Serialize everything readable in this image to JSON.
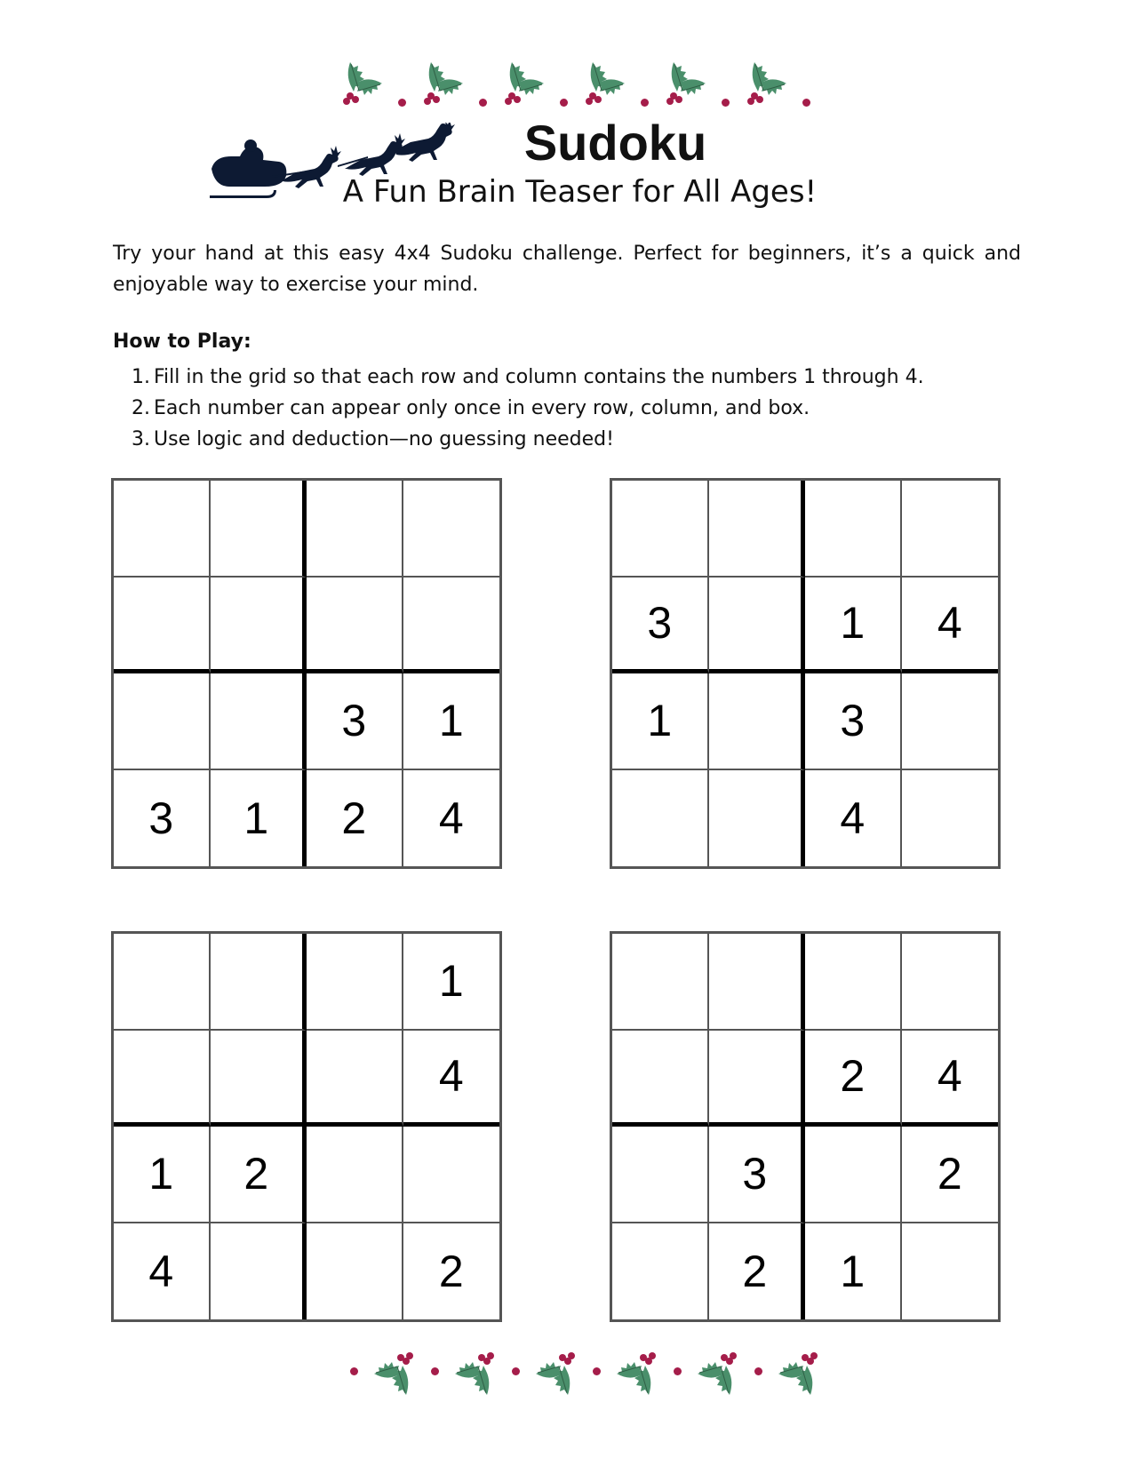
{
  "decoration": {
    "top_icons": [
      "holly-icon",
      "holly-icon",
      "holly-icon",
      "holly-icon",
      "holly-icon",
      "holly-icon"
    ],
    "bottom_icons": [
      "holly-icon",
      "holly-icon",
      "holly-icon",
      "holly-icon",
      "holly-icon",
      "holly-icon"
    ],
    "sleigh_icon": "santa-sleigh-reindeer-icon",
    "colors": {
      "leaf": "#4a8f6b",
      "berry": "#a51d4a",
      "sleigh": "#0d1a33"
    }
  },
  "header": {
    "title": "Sudoku",
    "subtitle": "A Fun Brain Teaser for All Ages!"
  },
  "intro": "Try your hand at this easy 4x4 Sudoku challenge. Perfect for beginners, it’s a quick and enjoyable way to exercise your mind.",
  "how_to_play": {
    "heading": "How to Play:",
    "rules": [
      {
        "num": "1.",
        "text": "Fill in the grid so that each row and column contains the numbers 1 through 4."
      },
      {
        "num": "2.",
        "text": "Each number can appear only once in every row, column, and box."
      },
      {
        "num": "3.",
        "text": "Use logic and deduction—no guessing needed!"
      }
    ]
  },
  "puzzles": [
    {
      "cells": [
        [
          "",
          "",
          "",
          ""
        ],
        [
          "",
          "",
          "",
          ""
        ],
        [
          "",
          "",
          "3",
          "1"
        ],
        [
          "3",
          "1",
          "2",
          "4"
        ]
      ]
    },
    {
      "cells": [
        [
          "",
          "",
          "",
          ""
        ],
        [
          "3",
          "",
          "1",
          "4"
        ],
        [
          "1",
          "",
          "3",
          ""
        ],
        [
          "",
          "",
          "4",
          ""
        ]
      ]
    },
    {
      "cells": [
        [
          "",
          "",
          "",
          "1"
        ],
        [
          "",
          "",
          "",
          "4"
        ],
        [
          "1",
          "2",
          "",
          ""
        ],
        [
          "4",
          "",
          "",
          "2"
        ]
      ]
    },
    {
      "cells": [
        [
          "",
          "",
          "",
          ""
        ],
        [
          "",
          "",
          "2",
          "4"
        ],
        [
          "",
          "3",
          "",
          "2"
        ],
        [
          "",
          "2",
          "1",
          ""
        ]
      ]
    }
  ]
}
